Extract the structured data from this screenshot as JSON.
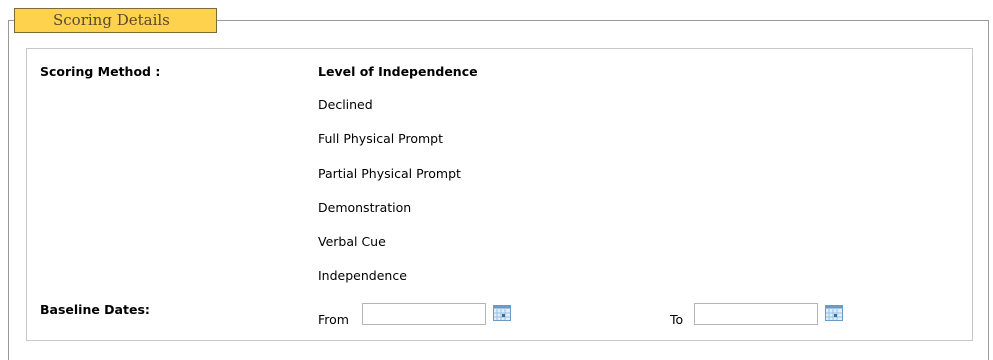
{
  "section": {
    "title": "Scoring Details"
  },
  "scoring_method": {
    "label": "Scoring Method :",
    "heading": "Level of Independence",
    "levels": [
      "Declined",
      "Full Physical Prompt",
      "Partial Physical Prompt",
      "Demonstration",
      "Verbal Cue",
      "Independence"
    ]
  },
  "baseline": {
    "label": "Baseline Dates:",
    "from_label": "From",
    "from_value": "",
    "to_label": "To",
    "to_value": "",
    "calendar_icon": "calendar-icon"
  },
  "colors": {
    "legend_bg": "#ffd24d",
    "legend_text": "#5a4a2a",
    "border": "#9a9a9a"
  }
}
